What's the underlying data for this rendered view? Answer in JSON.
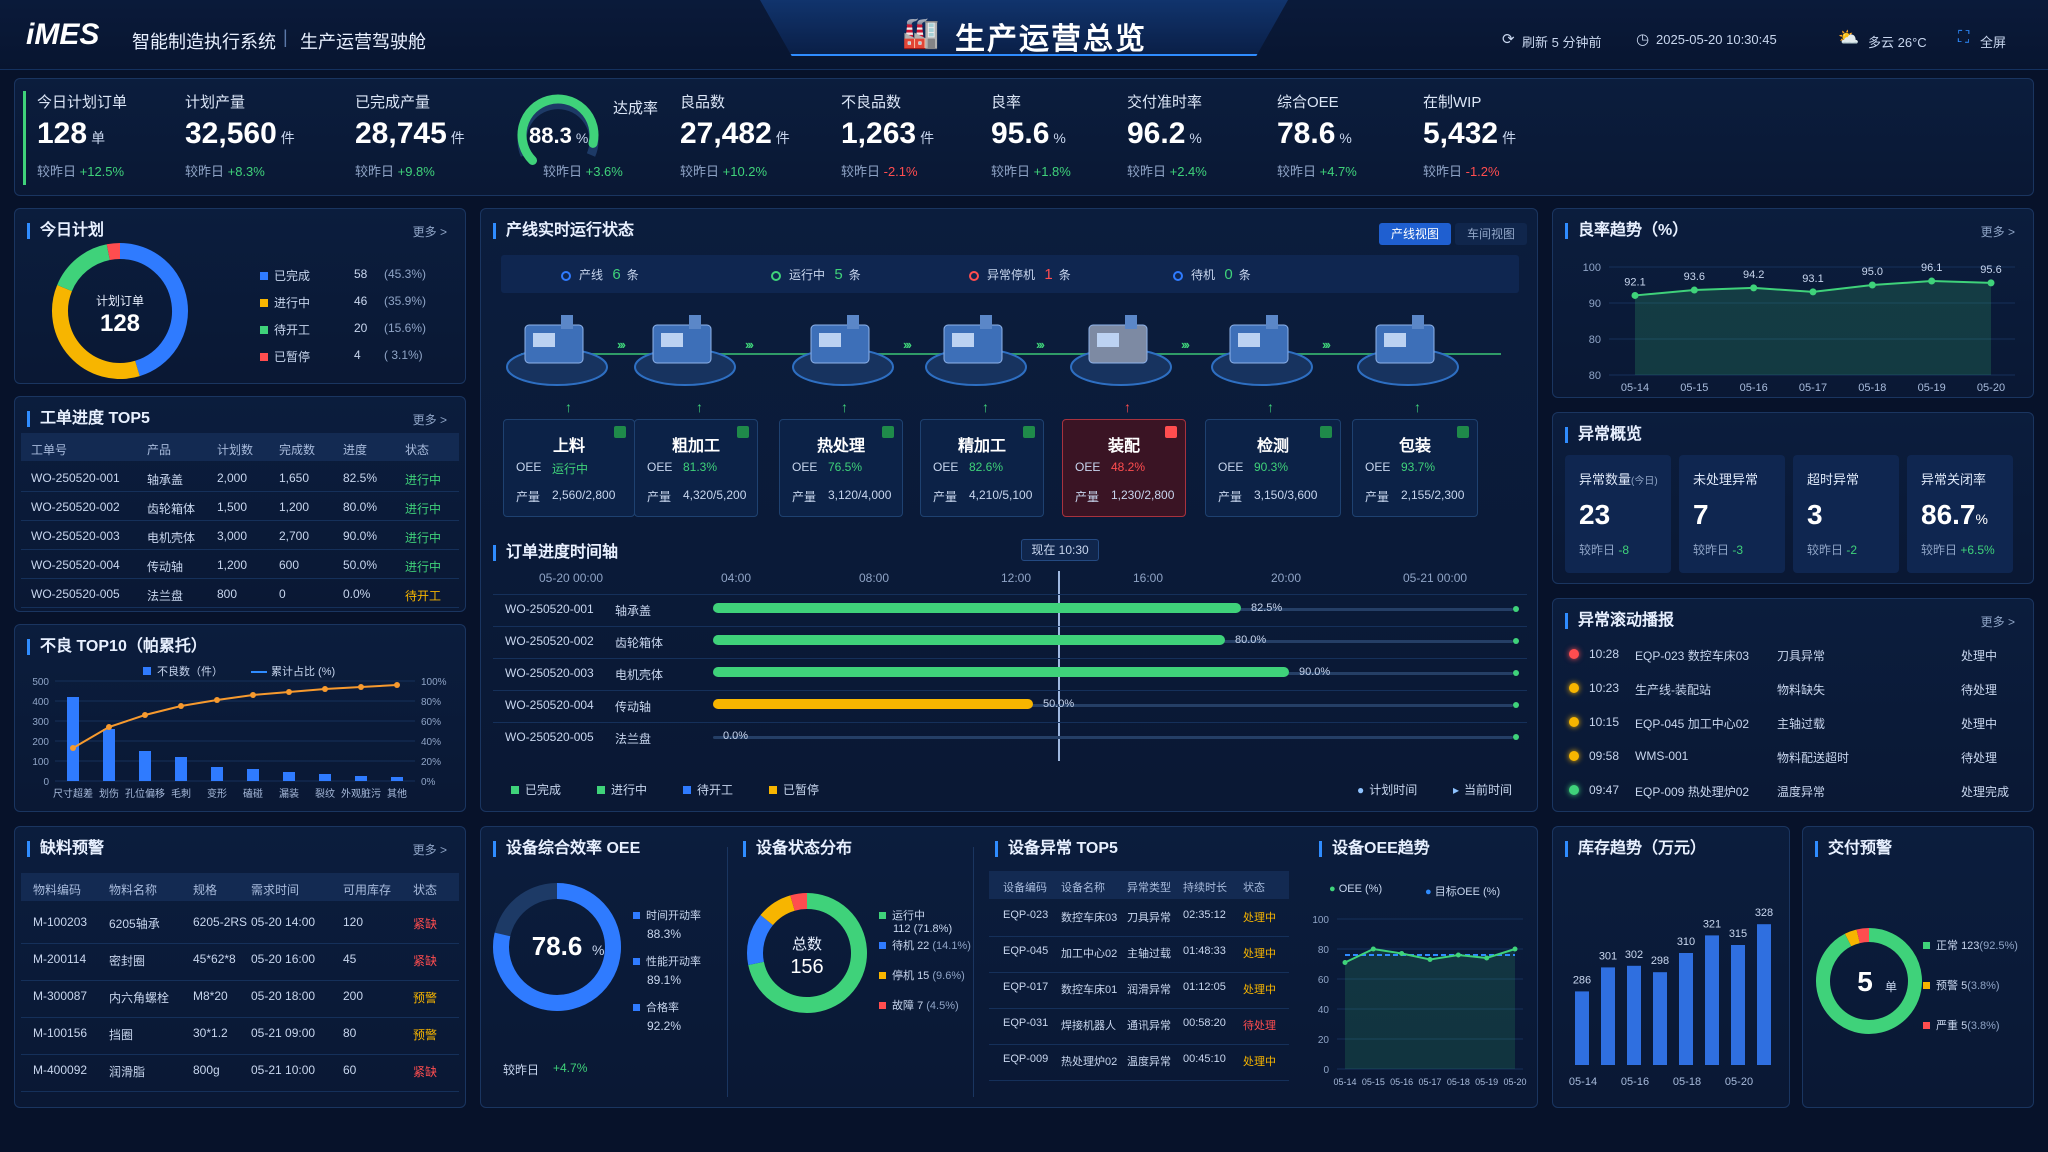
{
  "header": {
    "logo": "iMES",
    "system": "智能制造执行系统",
    "divider": "|",
    "subtitle": "生产运营驾驶舱",
    "title": "生产运营总览",
    "refresh": "刷新 5 分钟前",
    "datetime": "2025-05-20 10:30:45",
    "weather": "多云 26°C",
    "fullscreen": "全屏"
  },
  "kpis": [
    {
      "label": "今日计划订单",
      "value": "128",
      "unit": "单",
      "cmp": "较昨日",
      "delta": "+12.5%",
      "up": true
    },
    {
      "label": "计划产量",
      "value": "32,560",
      "unit": "件",
      "cmp": "较昨日",
      "delta": "+8.3%",
      "up": true
    },
    {
      "label": "已完成产量",
      "value": "28,745",
      "unit": "件",
      "cmp": "较昨日",
      "delta": "+9.8%",
      "up": true
    },
    {
      "label": "达成率",
      "value": "88.3",
      "unit": "%",
      "cmp": "较昨日",
      "delta": "+3.6%",
      "up": true,
      "gauge": 0.883
    },
    {
      "label": "良品数",
      "value": "27,482",
      "unit": "件",
      "cmp": "较昨日",
      "delta": "+10.2%",
      "up": true
    },
    {
      "label": "不良品数",
      "value": "1,263",
      "unit": "件",
      "cmp": "较昨日",
      "delta": "-2.1%",
      "up": false
    },
    {
      "label": "良率",
      "value": "95.6",
      "unit": "%",
      "cmp": "较昨日",
      "delta": "+1.8%",
      "up": true
    },
    {
      "label": "交付准时率",
      "value": "96.2",
      "unit": "%",
      "cmp": "较昨日",
      "delta": "+2.4%",
      "up": true
    },
    {
      "label": "综合OEE",
      "value": "78.6",
      "unit": "%",
      "cmp": "较昨日",
      "delta": "+4.7%",
      "up": true
    },
    {
      "label": "在制WIP",
      "value": "5,432",
      "unit": "件",
      "cmp": "较昨日",
      "delta": "-1.2%",
      "up": false
    }
  ],
  "plan": {
    "title": "今日计划",
    "more": "更多 >",
    "center_label": "计划订单",
    "center_value": "128",
    "items": [
      {
        "name": "已完成",
        "count": "58",
        "pct": "(45.3%)",
        "color": "#2f7bff",
        "v": 58
      },
      {
        "name": "进行中",
        "count": "46",
        "pct": "(35.9%)",
        "color": "#f7b500",
        "v": 46
      },
      {
        "name": "待开工",
        "count": "20",
        "pct": "(15.6%)",
        "color": "#3fd27a",
        "v": 20
      },
      {
        "name": "已暂停",
        "count": "4",
        "pct": "( 3.1%)",
        "color": "#ff4d4f",
        "v": 4
      }
    ]
  },
  "wo": {
    "title": "工单进度 TOP5",
    "more": "更多 >",
    "headers": [
      "工单号",
      "产品",
      "计划数",
      "完成数",
      "进度",
      "状态"
    ],
    "rows": [
      [
        "WO-250520-001",
        "轴承盖",
        "2,000",
        "1,650",
        "82.5%",
        "进行中"
      ],
      [
        "WO-250520-002",
        "齿轮箱体",
        "1,500",
        "1,200",
        "80.0%",
        "进行中"
      ],
      [
        "WO-250520-003",
        "电机壳体",
        "3,000",
        "2,700",
        "90.0%",
        "进行中"
      ],
      [
        "WO-250520-004",
        "传动轴",
        "1,200",
        "600",
        "50.0%",
        "进行中"
      ],
      [
        "WO-250520-005",
        "法兰盘",
        "800",
        "0",
        "0.0%",
        "待开工"
      ]
    ]
  },
  "defect": {
    "title": "不良 TOP10（帕累托）",
    "legend_bar": "不良数（件）",
    "legend_line": "累计占比 (%)",
    "categories": [
      "尺寸超差",
      "划伤",
      "孔位偏移",
      "毛刺",
      "变形",
      "磕碰",
      "漏装",
      "裂纹",
      "外观脏污",
      "其他"
    ],
    "values": [
      420,
      260,
      150,
      120,
      70,
      60,
      45,
      35,
      25,
      20
    ],
    "cum": [
      33,
      54,
      66,
      75,
      81,
      86,
      89,
      92,
      94,
      96
    ],
    "yticks": [
      "500",
      "400",
      "300",
      "200",
      "100",
      "0"
    ],
    "y2ticks": [
      "100%",
      "80%",
      "60%",
      "40%",
      "20%",
      "0%"
    ]
  },
  "shortage": {
    "title": "缺料预警",
    "more": "更多 >",
    "headers": [
      "物料编码",
      "物料名称",
      "规格",
      "需求时间",
      "可用库存",
      "状态"
    ],
    "rows": [
      [
        "M-100203",
        "6205轴承",
        "6205-2RS",
        "05-20 14:00",
        "120",
        "紧缺"
      ],
      [
        "M-200114",
        "密封圈",
        "45*62*8",
        "05-20 16:00",
        "45",
        "紧缺"
      ],
      [
        "M-300087",
        "内六角螺栓",
        "M8*20",
        "05-20 18:00",
        "200",
        "预警"
      ],
      [
        "M-100156",
        "挡圈",
        "30*1.2",
        "05-21 09:00",
        "80",
        "预警"
      ],
      [
        "M-400092",
        "润滑脂",
        "800g",
        "05-21 10:00",
        "60",
        "紧缺"
      ]
    ]
  },
  "line": {
    "title": "产线实时运行状态",
    "view1": "产线视图",
    "view2": "车间视图",
    "stats": [
      {
        "label": "产线",
        "count": "6",
        "unit": "条"
      },
      {
        "label": "运行中",
        "count": "5",
        "unit": "条"
      },
      {
        "label": "异常停机",
        "count": "1",
        "unit": "条"
      },
      {
        "label": "待机",
        "count": "0",
        "unit": "条"
      }
    ],
    "stations": [
      {
        "name": "上料",
        "oee_label": "OEE",
        "oee": "运行中",
        "out_label": "产量",
        "out": "2,560/2,800",
        "alarm": false
      },
      {
        "name": "粗加工",
        "oee_label": "OEE",
        "oee": "81.3%",
        "out_label": "产量",
        "out": "4,320/5,200",
        "alarm": false
      },
      {
        "name": "热处理",
        "oee_label": "OEE",
        "oee": "76.5%",
        "out_label": "产量",
        "out": "3,120/4,000",
        "alarm": false
      },
      {
        "name": "精加工",
        "oee_label": "OEE",
        "oee": "82.6%",
        "out_label": "产量",
        "out": "4,210/5,100",
        "alarm": false
      },
      {
        "name": "装配",
        "oee_label": "OEE",
        "oee": "48.2%",
        "out_label": "产量",
        "out": "1,230/2,800",
        "alarm": true
      },
      {
        "name": "检测",
        "oee_label": "OEE",
        "oee": "90.3%",
        "out_label": "产量",
        "out": "3,150/3,600",
        "alarm": false
      },
      {
        "name": "包装",
        "oee_label": "OEE",
        "oee": "93.7%",
        "out_label": "产量",
        "out": "2,155/2,300",
        "alarm": false
      }
    ]
  },
  "timeline": {
    "title": "订单进度时间轴",
    "now": "现在 10:30",
    "ticks": [
      "05-20 00:00",
      "04:00",
      "08:00",
      "12:00",
      "16:00",
      "20:00",
      "05-21 00:00"
    ],
    "rows": [
      {
        "wo": "WO-250520-001",
        "prod": "轴承盖",
        "pct": "82.5%",
        "p": 0.825,
        "color": "#3fd27a"
      },
      {
        "wo": "WO-250520-002",
        "prod": "齿轮箱体",
        "pct": "80.0%",
        "p": 0.8,
        "color": "#3fd27a"
      },
      {
        "wo": "WO-250520-003",
        "prod": "电机壳体",
        "pct": "90.0%",
        "p": 0.9,
        "color": "#3fd27a"
      },
      {
        "wo": "WO-250520-004",
        "prod": "传动轴",
        "pct": "50.0%",
        "p": 0.5,
        "color": "#f7b500"
      },
      {
        "wo": "WO-250520-005",
        "prod": "法兰盘",
        "pct": "0.0%",
        "p": 0,
        "color": "#3fd27a"
      }
    ],
    "legend": [
      "已完成",
      "进行中",
      "待开工",
      "已暂停"
    ],
    "legend_right": [
      "计划时间",
      "当前时间"
    ]
  },
  "yield": {
    "title": "良率趋势（%）",
    "more": "更多 >",
    "x": [
      "05-14",
      "05-15",
      "05-16",
      "05-17",
      "05-18",
      "05-19",
      "05-20"
    ],
    "y": [
      92.1,
      93.6,
      94.2,
      93.1,
      95.0,
      96.1,
      95.6
    ],
    "labels": [
      "92.1",
      "93.6",
      "94.2",
      "93.1",
      "95.0",
      "96.1",
      "95.6"
    ],
    "yticks": [
      "100",
      "90",
      "80",
      "80"
    ]
  },
  "abnormal": {
    "title": "异常概览",
    "cards": [
      {
        "label": "异常数量",
        "sub": "(今日)",
        "value": "23",
        "unit": "",
        "cmp": "较昨日",
        "delta": "-8",
        "good": true
      },
      {
        "label": "未处理异常",
        "sub": "",
        "value": "7",
        "unit": "",
        "cmp": "较昨日",
        "delta": "-3",
        "good": true
      },
      {
        "label": "超时异常",
        "sub": "",
        "value": "3",
        "unit": "",
        "cmp": "较昨日",
        "delta": "-2",
        "good": true
      },
      {
        "label": "异常关闭率",
        "sub": "",
        "value": "86.7",
        "unit": "%",
        "cmp": "较昨日",
        "delta": "+6.5%",
        "good": true
      }
    ]
  },
  "broadcast": {
    "title": "异常滚动播报",
    "more": "更多 >",
    "items": [
      {
        "time": "10:28",
        "dev": "EQP-023 数控车床03",
        "issue": "刀具异常",
        "status": "处理中",
        "color": "#ff4d4f"
      },
      {
        "time": "10:23",
        "dev": "生产线-装配站",
        "issue": "物料缺失",
        "status": "待处理",
        "color": "#f7b500"
      },
      {
        "time": "10:15",
        "dev": "EQP-045 加工中心02",
        "issue": "主轴过载",
        "status": "处理中",
        "color": "#f7b500"
      },
      {
        "time": "09:58",
        "dev": "WMS-001",
        "issue": "物料配送超时",
        "status": "待处理",
        "color": "#f7b500"
      },
      {
        "time": "09:47",
        "dev": "EQP-009 热处理炉02",
        "issue": "温度异常",
        "status": "处理完成",
        "color": "#3fd27a"
      }
    ]
  },
  "oee": {
    "title": "设备综合效率 OEE",
    "value": "78.6",
    "unit": "%",
    "cmp": "较昨日",
    "delta": "+4.7%",
    "items": [
      {
        "name": "时间开动率",
        "val": "88.3%",
        "color": "#2f7bff"
      },
      {
        "name": "性能开动率",
        "val": "89.1%",
        "color": "#2f7bff"
      },
      {
        "name": "合格率",
        "val": "92.2%",
        "color": "#2f7bff"
      }
    ]
  },
  "devstate": {
    "title": "设备状态分布",
    "center_label": "总数",
    "center_value": "156",
    "items": [
      {
        "name": "运行中",
        "val": "112",
        "pct": "(71.8%)",
        "color": "#3fd27a",
        "v": 112
      },
      {
        "name": "待机",
        "val": "22",
        "pct": "(14.1%)",
        "color": "#2f7bff",
        "v": 22
      },
      {
        "name": "停机",
        "val": "15",
        "pct": "(9.6%)",
        "color": "#f7b500",
        "v": 15
      },
      {
        "name": "故障",
        "val": "7",
        "pct": "(4.5%)",
        "color": "#ff4d4f",
        "v": 7
      }
    ]
  },
  "devabn": {
    "title": "设备异常 TOP5",
    "headers": [
      "设备编码",
      "设备名称",
      "异常类型",
      "持续时长",
      "状态"
    ],
    "rows": [
      [
        "EQP-023",
        "数控车床03",
        "刀具异常",
        "02:35:12",
        "处理中"
      ],
      [
        "EQP-045",
        "加工中心02",
        "主轴过载",
        "01:48:33",
        "处理中"
      ],
      [
        "EQP-017",
        "数控车床01",
        "润滑异常",
        "01:12:05",
        "处理中"
      ],
      [
        "EQP-031",
        "焊接机器人",
        "通讯异常",
        "00:58:20",
        "待处理"
      ],
      [
        "EQP-009",
        "热处理炉02",
        "温度异常",
        "00:45:10",
        "处理中"
      ]
    ]
  },
  "oeetrend": {
    "title": "设备OEE趋势",
    "legend1": "OEE (%)",
    "legend2": "目标OEE (%)",
    "x": [
      "05-14",
      "05-15",
      "05-16",
      "05-17",
      "05-18",
      "05-19",
      "05-20"
    ],
    "oee": [
      71,
      80,
      77,
      73,
      76,
      74,
      80
    ],
    "target": [
      76,
      76,
      76,
      76,
      76,
      76,
      76
    ],
    "yticks": [
      "100",
      "80",
      "60",
      "40",
      "20",
      "0"
    ],
    "ylim": [
      0,
      100
    ]
  },
  "inventory": {
    "title": "库存趋势（万元）",
    "x": [
      "05-14",
      "05-16",
      "05-18",
      "05-20"
    ],
    "values": [
      286,
      301,
      302,
      298,
      310,
      321,
      315,
      328
    ],
    "labels": [
      "286",
      "301",
      "302",
      "298",
      "310",
      "321",
      "315",
      "328"
    ]
  },
  "delivery": {
    "title": "交付预警",
    "center_value": "5",
    "center_unit": "单",
    "items": [
      {
        "name": "正常",
        "val": "123",
        "pct": "(92.5%)",
        "color": "#3fd27a",
        "v": 123
      },
      {
        "name": "预警",
        "val": "5",
        "pct": "(3.8%)",
        "color": "#f7b500",
        "v": 5
      },
      {
        "name": "严重",
        "val": "5",
        "pct": "(3.8%)",
        "color": "#ff4d4f",
        "v": 5
      }
    ]
  }
}
